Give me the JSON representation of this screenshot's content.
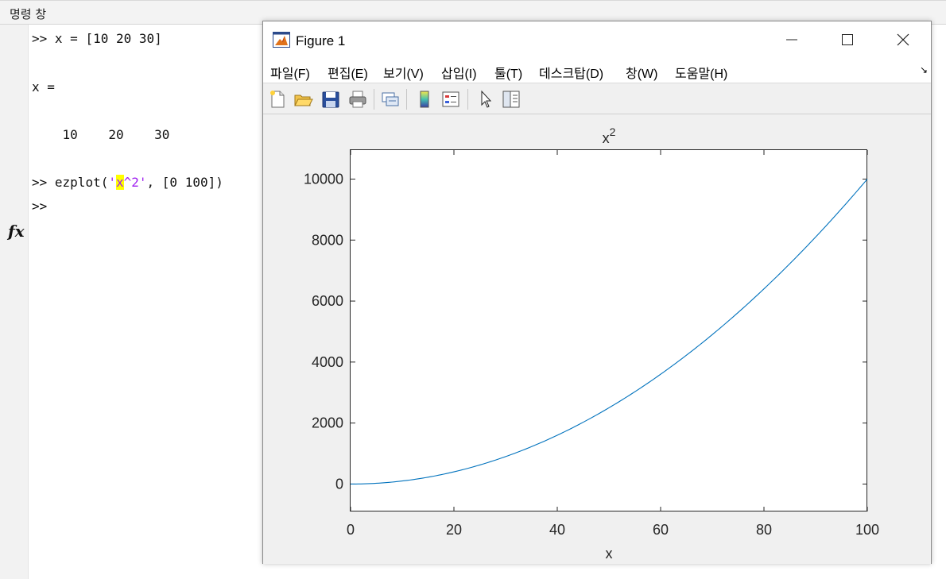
{
  "command_window": {
    "title": "명령 창",
    "lines": [
      {
        "prompt": ">> ",
        "pre": "x = [10 20 30]",
        "hl": "",
        "str": "",
        "post": ""
      },
      {
        "prompt": "",
        "pre": "x =",
        "hl": "",
        "str": "",
        "post": ""
      },
      {
        "prompt": "",
        "pre": "    10    20    30",
        "hl": "",
        "str": "",
        "post": ""
      },
      {
        "prompt": ">> ",
        "pre": "ezplot(",
        "str_open": "'",
        "hl": "x",
        "str": "^2'",
        "post": ", [0 100])"
      },
      {
        "prompt": ">> ",
        "pre": "",
        "hl": "",
        "str": "",
        "post": ""
      }
    ],
    "fx_icon": "fx-icon"
  },
  "figure": {
    "title": "Figure 1",
    "icon": "matlab-icon",
    "window_buttons": [
      "minimize-icon",
      "maximize-icon",
      "close-icon"
    ],
    "menu": [
      "파일(F)",
      "편집(E)",
      "보기(V)",
      "삽입(I)",
      "툴(T)",
      "데스크탑(D)",
      "창(W)",
      "도움말(H)"
    ],
    "menu_dock_glyph": "↘",
    "toolbar": [
      "new-figure-icon",
      "open-file-icon",
      "save-icon",
      "print-icon",
      "link-icon",
      "colorbar-icon",
      "legend-icon",
      "pointer-icon",
      "property-inspector-icon"
    ]
  },
  "chart_data": {
    "type": "line",
    "title_base": "x",
    "title_sup": "2",
    "xlabel": "x",
    "ylabel": "",
    "xlim": [
      0,
      100
    ],
    "ylim": [
      -900,
      10950
    ],
    "xticks": [
      0,
      20,
      40,
      60,
      80,
      100
    ],
    "yticks": [
      0,
      2000,
      4000,
      6000,
      8000,
      10000
    ],
    "function": "x^2",
    "series": [
      {
        "color": "#0072bd"
      }
    ],
    "grid": false
  }
}
